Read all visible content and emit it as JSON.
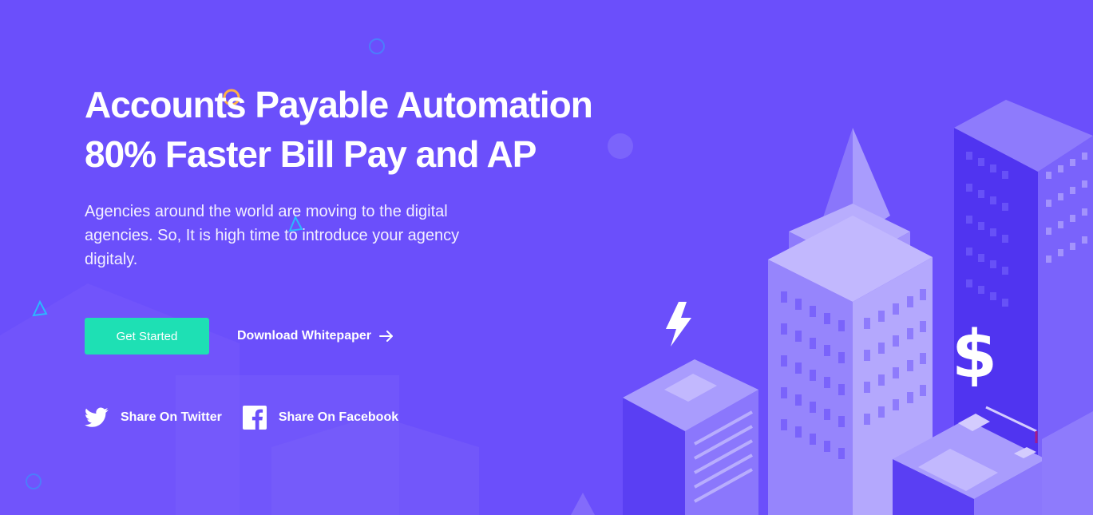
{
  "hero": {
    "title_line1": "Accounts Payable Automation",
    "title_line2": "80% Faster Bill Pay and AP",
    "description": "Agencies around the world are moving to the digital agencies. So, It is high time to introduce your agency digitaly."
  },
  "cta": {
    "primary_label": "Get Started",
    "secondary_label": "Download Whitepaper"
  },
  "share": {
    "twitter_label": "Share On Twitter",
    "facebook_label": "Share On Facebook"
  },
  "illustration": {
    "dollar_symbol": "$"
  },
  "colors": {
    "background": "#6b4ffb",
    "primary_button": "#1ee0b4"
  },
  "icons": [
    "twitter-icon",
    "facebook-icon",
    "arrow-right-icon",
    "lightning-icon",
    "dollar-icon"
  ]
}
